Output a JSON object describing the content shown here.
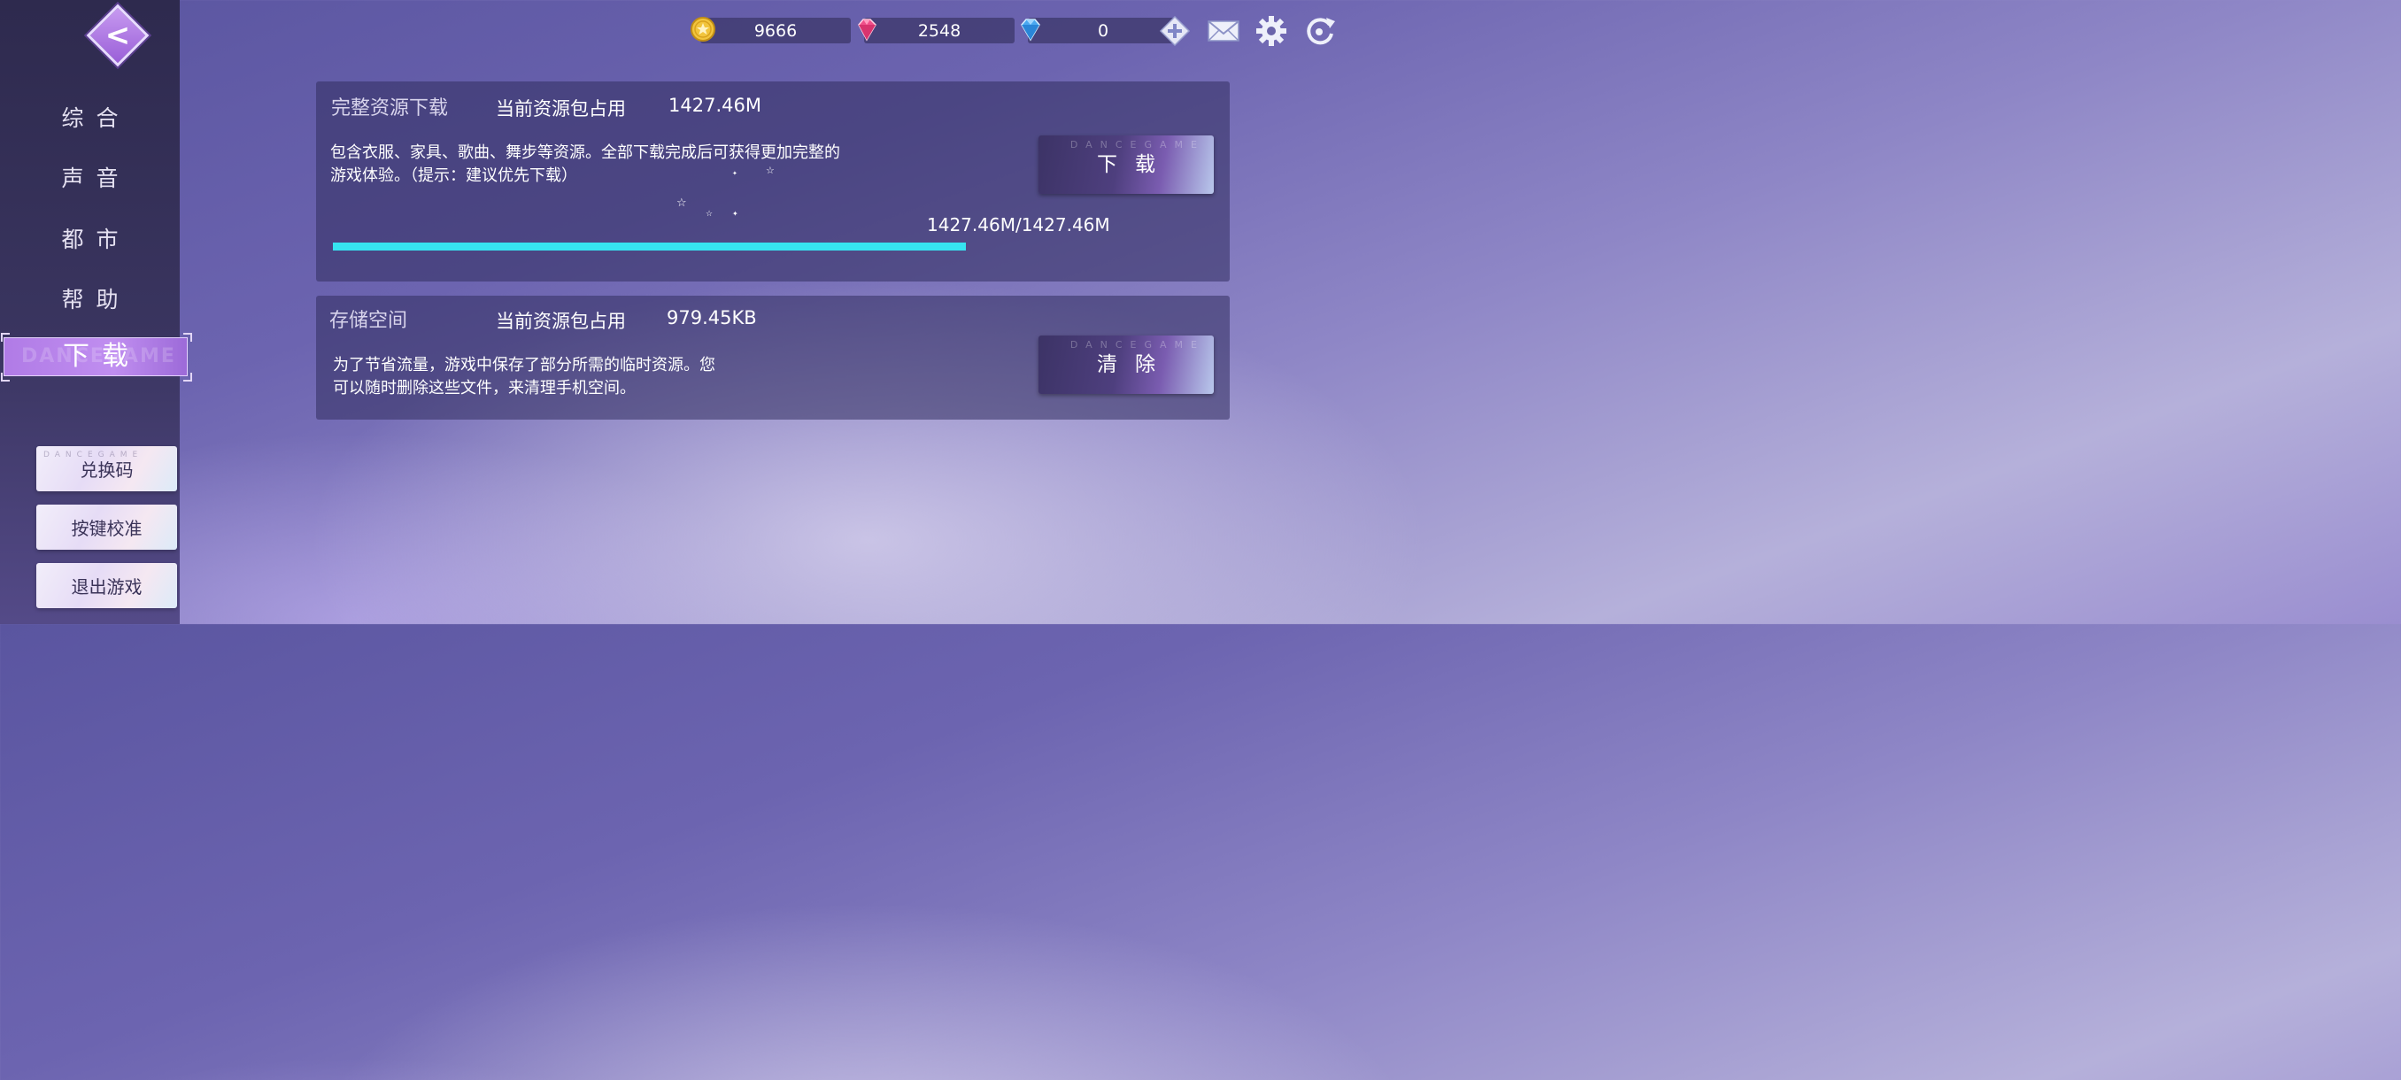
{
  "topbar": {
    "gold": "9666",
    "pink_gem": "2548",
    "blue_diamond": "0"
  },
  "sidebar": {
    "nav": [
      {
        "label": "综合"
      },
      {
        "label": "声音"
      },
      {
        "label": "都市"
      },
      {
        "label": "帮助"
      },
      {
        "label": "下载",
        "active": true
      }
    ],
    "nav_watermark": "DANCEGAME",
    "buttons": [
      {
        "label": "兑换码"
      },
      {
        "label": "按键校准"
      },
      {
        "label": "退出游戏"
      }
    ]
  },
  "download_panel": {
    "title": "完整资源下载",
    "usage_label": "当前资源包占用",
    "usage_value": "1427.46M",
    "description_line1": "包含衣服、家具、歌曲、舞步等资源。全部下载完成后可获得更加完整的",
    "description_line2": "游戏体验。（提示：建议优先下载）",
    "progress_text": "1427.46M/1427.46M",
    "progress_fraction": 1.0,
    "button_label": "下载"
  },
  "storage_panel": {
    "title": "存储空间",
    "usage_label": "当前资源包占用",
    "usage_value": "979.45KB",
    "description_line1": "为了节省流量，游戏中保存了部分所需的临时资源。您",
    "description_line2": "可以随时删除这些文件，来清理手机空间。",
    "button_label": "清除"
  },
  "button_watermark": "DANCEGAME",
  "colors": {
    "progress": "#36e4f0",
    "active_tab": "#b07be6"
  }
}
